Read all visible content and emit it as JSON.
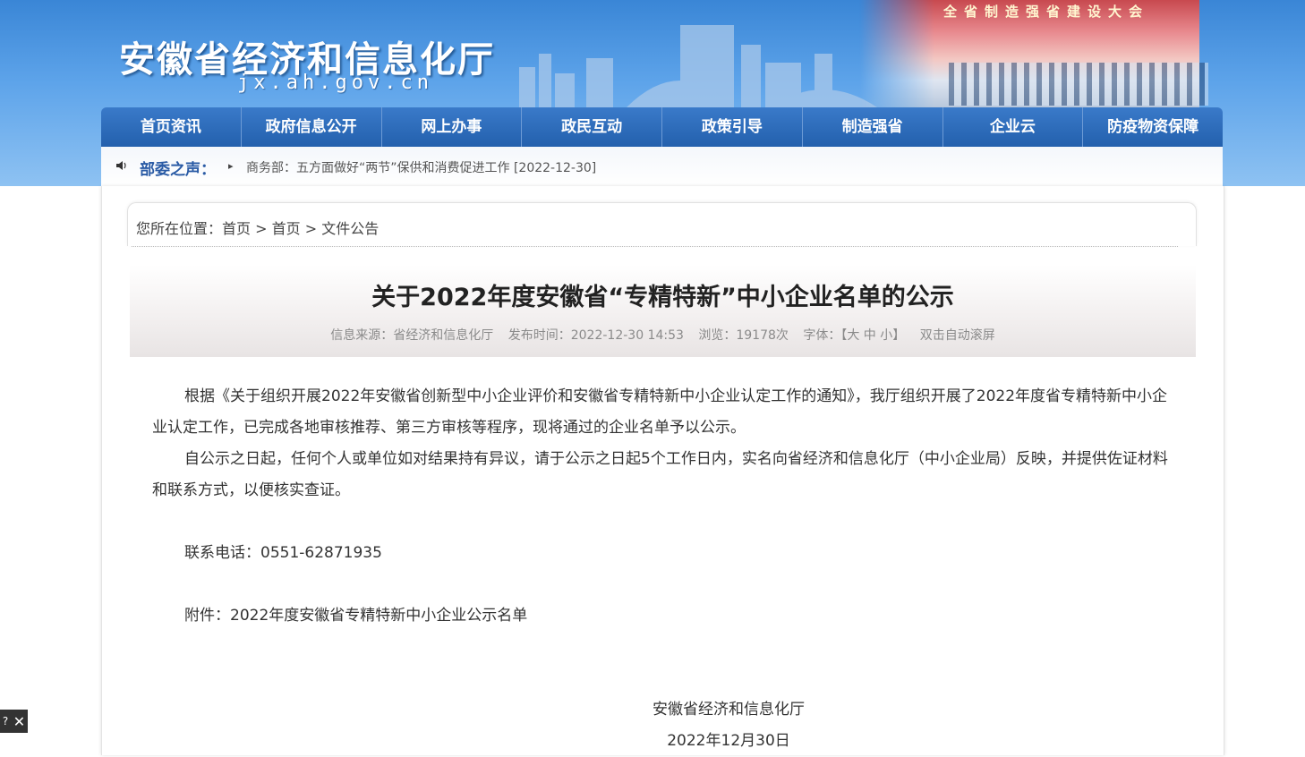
{
  "header": {
    "site_title": "安徽省经济和信息化厅",
    "site_domain": "jx.ah.gov.cn",
    "banner_caption": "全省制造强省建设大会"
  },
  "nav": {
    "items": [
      "首页资讯",
      "政府信息公开",
      "网上办事",
      "政民互动",
      "政策引导",
      "制造强省",
      "企业云",
      "防疫物资保障"
    ]
  },
  "ticker": {
    "label": "部委之声：",
    "news": "商务部：五方面做好“两节”保供和消费促进工作 [2022-12-30]"
  },
  "breadcrumb": {
    "prefix": "您所在位置：",
    "items": [
      "首页",
      "首页",
      "文件公告"
    ],
    "separator": ">"
  },
  "article": {
    "title": "关于2022年度安徽省“专精特新”中小企业名单的公示",
    "meta": {
      "source": "信息来源：省经济和信息化厅",
      "published": "发布时间：2022-12-30 14:53",
      "views": "浏览：19178次",
      "font_label": "字体：",
      "font_sizes": "【大 中 小】",
      "autoscroll": "双击自动滚屏"
    },
    "paragraphs": [
      "根据《关于组织开展2022年安徽省创新型中小企业评价和安徽省专精特新中小企业认定工作的通知》，我厅组织开展了2022年度省专精特新中小企业认定工作，已完成各地审核推荐、第三方审核等程序，现将通过的企业名单予以公示。",
      "自公示之日起，任何个人或单位如对结果持有异议，请于公示之日起5个工作日内，实名向省经济和信息化厅（中小企业局）反映，并提供佐证材料和联系方式，以便核实查证。"
    ],
    "contact": "联系电话：0551-62871935",
    "attachment": "附件：2022年度安徽省专精特新中小企业公示名单",
    "signature": "安徽省经济和信息化厅",
    "date": "2022年12月30日"
  },
  "widget": {
    "help": "?",
    "close": "✕"
  },
  "colors": {
    "nav": "#2a66b3",
    "ticker_label": "#2a5ba5",
    "banner": "#4b95e0"
  }
}
